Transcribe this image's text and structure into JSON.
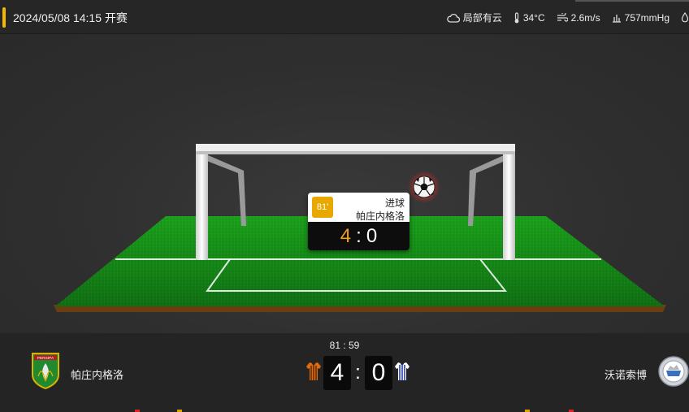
{
  "header": {
    "match_time": "2024/05/08 14:15 开赛",
    "accent_color": "#f5b800",
    "weather": {
      "condition": "局部有云",
      "condition_icon": "cloud-icon",
      "temperature": "34°C",
      "temperature_icon": "thermometer-icon",
      "wind": "2.6m/s",
      "wind_icon": "wind-icon",
      "pressure": "757mmHg",
      "pressure_icon": "pressure-icon",
      "humidity_icon": "droplet-icon"
    }
  },
  "event": {
    "minute": "81'",
    "type": "进球",
    "team": "帕庄内格洛",
    "score_home": "4",
    "score_sep": ":",
    "score_away": "0",
    "ball_icon": "soccer-ball-icon"
  },
  "scoreboard": {
    "clock": "81 : 59",
    "home": {
      "name": "帕庄内格洛",
      "logo": "persipa-crest-logo",
      "jersey_color": "#e06a10"
    },
    "away": {
      "name": "沃诺索博",
      "logo": "away-crest-logo",
      "jersey_color": "#2a3fb0"
    },
    "score_home": "4",
    "score_away": "0",
    "colon": ":"
  },
  "colors": {
    "pitch_green": "#1e8a1e",
    "home_score_highlight": "#f0a020",
    "minute_badge": "#e8a800"
  }
}
